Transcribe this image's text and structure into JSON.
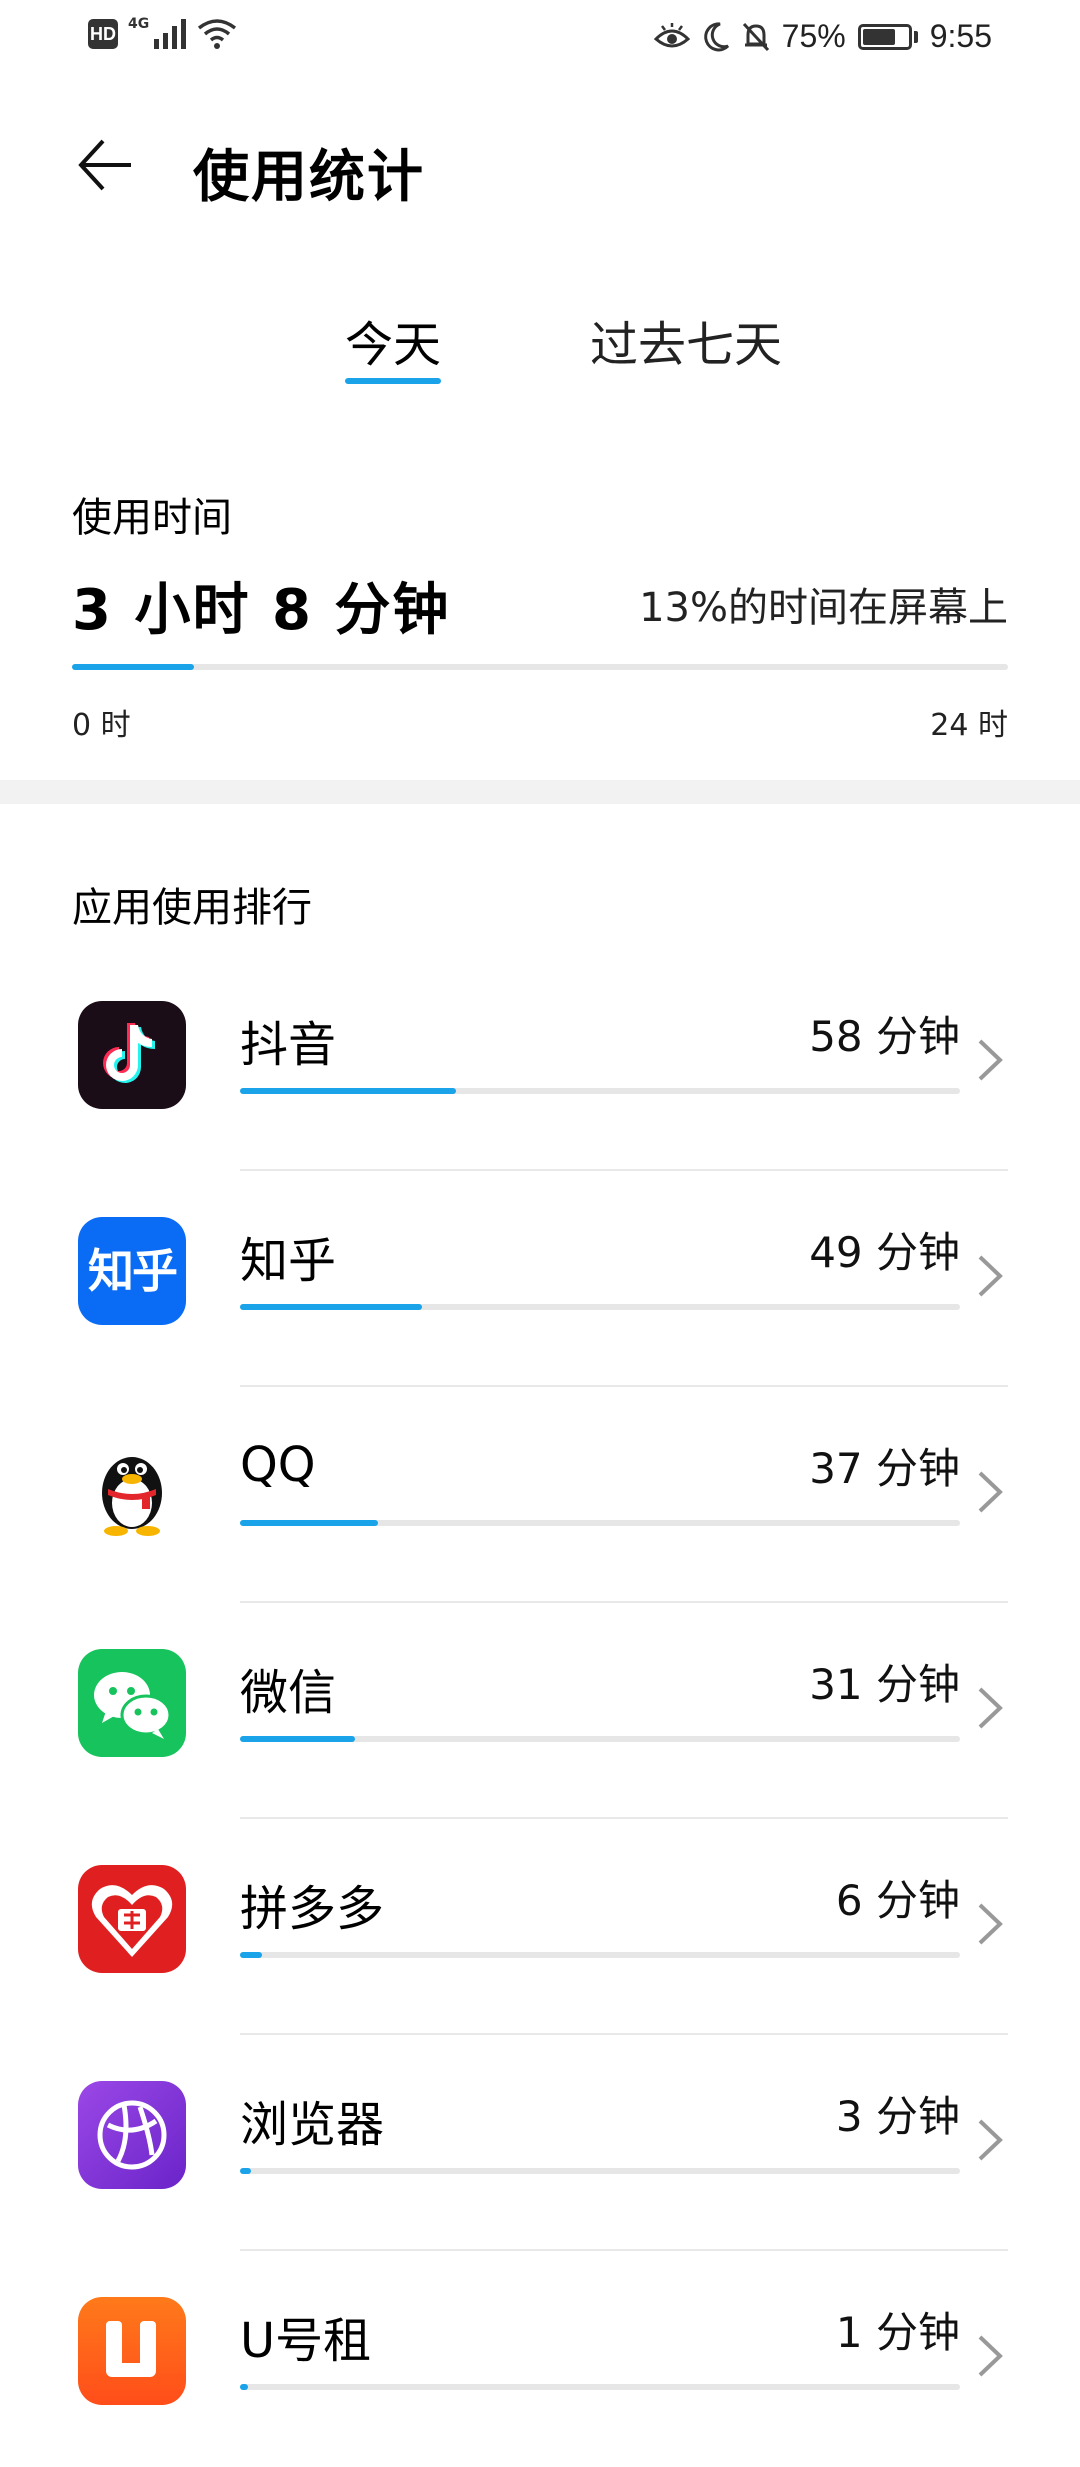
{
  "status_bar": {
    "hd": "HD",
    "network": "4G",
    "battery": "75%",
    "time": "9:55",
    "battery_level": 0.75
  },
  "header": {
    "title": "使用统计",
    "back_icon": "arrow-left-icon"
  },
  "tabs": {
    "today": "今天",
    "past_week": "过去七天",
    "active": "today"
  },
  "usage": {
    "label": "使用时间",
    "total": "3 小时 8 分钟",
    "percent_text": "13%的时间在屏幕上",
    "fraction": 0.13,
    "axis_min": "0 时",
    "axis_max": "24 时"
  },
  "ranking": {
    "title": "应用使用排行",
    "apps": [
      {
        "name": "抖音",
        "time": "58 分钟",
        "minutes": 58,
        "icon": "douyin-icon"
      },
      {
        "name": "知乎",
        "time": "49 分钟",
        "minutes": 49,
        "icon": "zhihu-icon",
        "icon_text": "知乎"
      },
      {
        "name": "QQ",
        "time": "37 分钟",
        "minutes": 37,
        "icon": "qq-icon"
      },
      {
        "name": "微信",
        "time": "31 分钟",
        "minutes": 31,
        "icon": "wechat-icon"
      },
      {
        "name": "拼多多",
        "time": "6 分钟",
        "minutes": 6,
        "icon": "pinduoduo-icon"
      },
      {
        "name": "浏览器",
        "time": "3 分钟",
        "minutes": 3,
        "icon": "browser-icon"
      },
      {
        "name": "U号租",
        "time": "1 分钟",
        "minutes": 1,
        "icon": "uhaozu-icon"
      }
    ]
  },
  "colors": {
    "accent": "#1aa3e8",
    "bar_track": "#e6e6e6"
  }
}
